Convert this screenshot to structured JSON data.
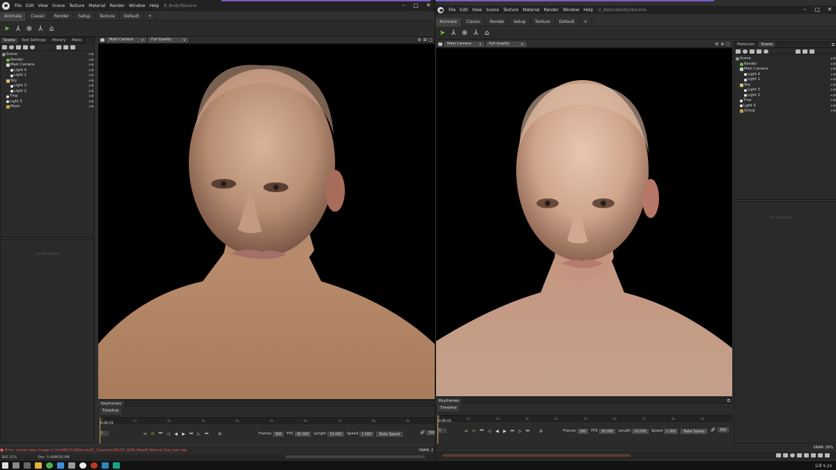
{
  "menu": [
    "File",
    "Edit",
    "View",
    "Scene",
    "Texture",
    "Material",
    "Render",
    "Window",
    "Help"
  ],
  "workspace_tabs": [
    "Animate",
    "Classic",
    "Render",
    "Setup",
    "Texture",
    "Default",
    "+"
  ],
  "left_window": {
    "title": "B_Body.tbscene",
    "panel_tabs": [
      "Scene",
      "Tool Settings",
      "History",
      "Mate"
    ],
    "tree": [
      {
        "label": "Scene",
        "icon": "scene"
      },
      {
        "label": "Render",
        "icon": "render"
      },
      {
        "label": "Main Camera",
        "icon": "camera"
      },
      {
        "label": "Light 4",
        "icon": "light"
      },
      {
        "label": "Light 1",
        "icon": "light"
      },
      {
        "label": "Sky",
        "icon": "sky"
      },
      {
        "label": "Light 3",
        "icon": "light"
      },
      {
        "label": "Light 2",
        "icon": "light"
      },
      {
        "label": "Tmp",
        "icon": "light"
      },
      {
        "label": "Light 5",
        "icon": "light"
      },
      {
        "label": "Mesh",
        "icon": "folder"
      }
    ],
    "no_selection": "No Selection",
    "viewport": {
      "camera": "Main Camera",
      "quality": "Full Quality"
    },
    "keyframes_tab": "Keyframes",
    "timeline_tab": "Timeline",
    "frame_value": "1",
    "time_value": "0:00.01",
    "ruler_labels": [
      "1s",
      "2s",
      "3s",
      "4s",
      "5s",
      "6s",
      "7s",
      "8s",
      "9s"
    ],
    "frames_label": "Frames",
    "frames_value": "300",
    "fps_label": "FPS",
    "fps_value": "30.000",
    "length_label": "Length",
    "length_value": "10.000",
    "speed_label": "Speed",
    "speed_value": "1.000",
    "bake_label": "Bake Speed",
    "end_frame": "300",
    "error_text": "Error: cannot open image C:/cml4B13CON/trunk/01_Character/BG/01_B/06_Map/B_Natural_Eye_spec.tga",
    "vram": "VRAM: 2",
    "status_left": "395.31%",
    "status_doc": "Doc: 5.69M/35.9M"
  },
  "right_window": {
    "title": "G_Naturalbody.tbscene",
    "panel_tabs": [
      "Materials",
      "Scene"
    ],
    "tree": [
      {
        "label": "Scene",
        "icon": "scene"
      },
      {
        "label": "Render",
        "icon": "render"
      },
      {
        "label": "Main Camera",
        "icon": "camera"
      },
      {
        "label": "Light 4",
        "icon": "light"
      },
      {
        "label": "Light 1",
        "icon": "light"
      },
      {
        "label": "Sky",
        "icon": "sky"
      },
      {
        "label": "Light 3",
        "icon": "light"
      },
      {
        "label": "Light 2",
        "icon": "light"
      },
      {
        "label": "Tmp",
        "icon": "light"
      },
      {
        "label": "Light 5",
        "icon": "light"
      },
      {
        "label": "Group",
        "icon": "folder"
      }
    ],
    "no_selection": "No Selection",
    "viewport": {
      "camera": "Main Camera",
      "quality": "Full Quality"
    },
    "keyframes_tab": "Keyframes",
    "timeline_tab": "Timeline",
    "frame_value": "1",
    "time_value": "0:00.01",
    "ruler_labels": [
      "1s",
      "2s",
      "3s",
      "4s",
      "5s",
      "6s",
      "7s",
      "8s",
      "9s"
    ],
    "frames_label": "Frames",
    "frames_value": "300",
    "fps_label": "FPS",
    "fps_value": "30.000",
    "length_label": "Length",
    "length_value": "10.000",
    "speed_label": "Speed",
    "speed_value": "1.000",
    "bake_label": "Bake Speed",
    "end_frame": "300",
    "vram": "VRAM: 26%"
  },
  "taskbar": {
    "clock": "오후 5:23"
  },
  "colors": {
    "accent_purple": "#7b5ccb",
    "green_tool": "#74d040",
    "error_red": "#e05a5a",
    "playhead": "#d9b14a"
  }
}
